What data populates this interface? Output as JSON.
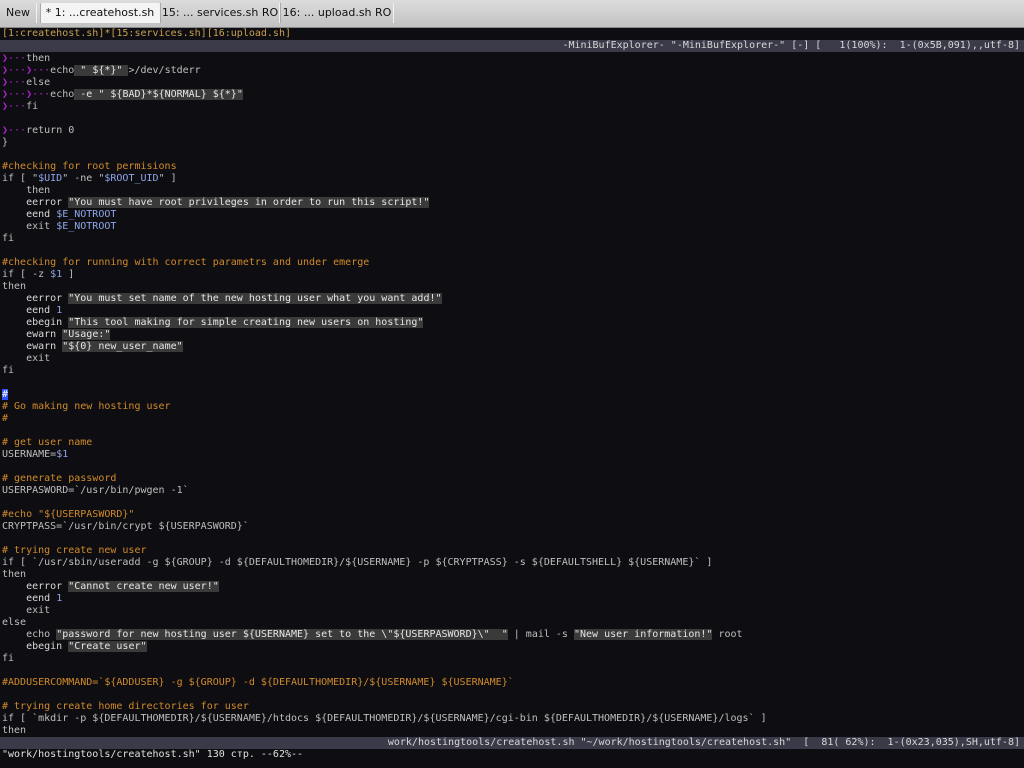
{
  "tabs": [
    {
      "label": "New"
    },
    {
      "label": "* 1: ...createhost.sh"
    },
    {
      "label": "15: ... services.sh RO"
    },
    {
      "label": "16: ... upload.sh RO"
    }
  ],
  "buffer_list": "[1:createhost.sh]*[15:services.sh][16:upload.sh]",
  "minibuf_status": "-MiniBufExplorer- \"-MiniBufExplorer-\" [-] [   1(100%):  1-(0x5B,091),,utf-8]",
  "main_status": "work/hostingtools/createhost.sh \"~/work/hostingtools/createhost.sh\"  [  81( 62%):  1-(0x23,035),SH,utf-8]",
  "cmdline": "\"work/hostingtools/createhost.sh\" 130 стр. --62%--",
  "code_lines": [
    [
      [
        "❯···",
        "ind"
      ],
      [
        "then",
        "kw"
      ]
    ],
    [
      [
        "❯···❯···",
        "ind"
      ],
      [
        "echo",
        "kw"
      ],
      [
        " \" ${*}\" ",
        "str"
      ],
      [
        ">/dev/stderr",
        "kw"
      ]
    ],
    [
      [
        "❯···",
        "ind"
      ],
      [
        "else",
        "kw"
      ]
    ],
    [
      [
        "❯···❯···",
        "ind"
      ],
      [
        "echo",
        "kw"
      ],
      [
        " -e ",
        "str"
      ],
      [
        "\" ${BAD}*${NORMAL} ${*}\"",
        "str"
      ]
    ],
    [
      [
        "❯···",
        "ind"
      ],
      [
        "fi",
        "kw"
      ]
    ],
    [],
    [
      [
        "❯···",
        "ind"
      ],
      [
        "return 0",
        "kw"
      ]
    ],
    [
      [
        "}",
        "kw"
      ]
    ],
    [],
    [
      [
        "#checking for root permisions",
        "cmt"
      ]
    ],
    [
      [
        "if [ \"",
        "kw"
      ],
      [
        "$UID",
        "var"
      ],
      [
        "\" -ne \"",
        "kw"
      ],
      [
        "$ROOT_UID",
        "var"
      ],
      [
        "\" ]",
        "kw"
      ]
    ],
    [
      [
        "    then",
        "kw"
      ]
    ],
    [
      [
        "    eerror ",
        "fn"
      ],
      [
        "\"You must have root privileges in order to run this script!\"",
        "str"
      ]
    ],
    [
      [
        "    eend ",
        "fn"
      ],
      [
        "$E_NOTROOT",
        "var"
      ]
    ],
    [
      [
        "    exit ",
        "kw"
      ],
      [
        "$E_NOTROOT",
        "var"
      ]
    ],
    [
      [
        "fi",
        "kw"
      ]
    ],
    [],
    [
      [
        "#checking for running with correct parametrs and under emerge",
        "cmt"
      ]
    ],
    [
      [
        "if [ -z ",
        "kw"
      ],
      [
        "$1",
        "var"
      ],
      [
        " ]",
        "kw"
      ]
    ],
    [
      [
        "then",
        "kw"
      ]
    ],
    [
      [
        "    eerror ",
        "fn"
      ],
      [
        "\"You must set name of the new hosting user what you want add!\"",
        "str"
      ]
    ],
    [
      [
        "    eend ",
        "fn"
      ],
      [
        "1",
        "num"
      ]
    ],
    [
      [
        "    ebegin ",
        "fn"
      ],
      [
        "\"This tool making for simple creating new users on hosting\"",
        "str"
      ]
    ],
    [
      [
        "    ewarn ",
        "fn"
      ],
      [
        "\"Usage:\"",
        "str"
      ]
    ],
    [
      [
        "    ewarn ",
        "fn"
      ],
      [
        "\"${0} new_user_name\"",
        "str"
      ]
    ],
    [
      [
        "    exit",
        "kw"
      ]
    ],
    [
      [
        "fi",
        "kw"
      ]
    ],
    [],
    [
      [
        "#",
        "cur"
      ]
    ],
    [
      [
        "# Go making new hosting user",
        "cmt"
      ]
    ],
    [
      [
        "#",
        "cmt"
      ]
    ],
    [],
    [
      [
        "# get user name",
        "cmt"
      ]
    ],
    [
      [
        "USERNAME=",
        "kw"
      ],
      [
        "$1",
        "var"
      ]
    ],
    [],
    [
      [
        "# generate password",
        "cmt"
      ]
    ],
    [
      [
        "USERPASWORD=`/usr/bin/pwgen -1`",
        "kw"
      ]
    ],
    [],
    [
      [
        "#echo \"${USERPASWORD}\"",
        "cmt"
      ]
    ],
    [
      [
        "CRYPTPASS=`/usr/bin/crypt ${USERPASWORD}`",
        "kw"
      ]
    ],
    [],
    [
      [
        "# trying create new user",
        "cmt"
      ]
    ],
    [
      [
        "if [ `/usr/sbin/useradd -g ${GROUP} -d ${DEFAULTHOMEDIR}/${USERNAME} -p ${CRYPTPASS} -s ${DEFAULTSHELL} ${USERNAME}` ]",
        "kw"
      ]
    ],
    [
      [
        "then",
        "kw"
      ]
    ],
    [
      [
        "    eerror ",
        "fn"
      ],
      [
        "\"Cannot create new user!\"",
        "str"
      ]
    ],
    [
      [
        "    eend ",
        "fn"
      ],
      [
        "1",
        "num"
      ]
    ],
    [
      [
        "    exit",
        "kw"
      ]
    ],
    [
      [
        "else",
        "kw"
      ]
    ],
    [
      [
        "    echo ",
        "kw"
      ],
      [
        "\"password for new hosting user ${USERNAME} set to the \\\"${USERPASWORD}\\\"  \"",
        "str"
      ],
      [
        " | mail -s ",
        "kw"
      ],
      [
        "\"New user information!\"",
        "str"
      ],
      [
        " root",
        "kw"
      ]
    ],
    [
      [
        "    ebegin ",
        "fn"
      ],
      [
        "\"Create user\"",
        "str"
      ]
    ],
    [
      [
        "fi",
        "kw"
      ]
    ],
    [],
    [
      [
        "#ADDUSERCOMMAND=`${ADDUSER} -g ${GROUP} -d ${DEFAULTHOMEDIR}/${USERNAME} ${USERNAME}`",
        "cmt"
      ]
    ],
    [],
    [
      [
        "# trying create home directories for user",
        "cmt"
      ]
    ],
    [
      [
        "if [ `mkdir -p ${DEFAULTHOMEDIR}/${USERNAME}/htdocs ${DEFAULTHOMEDIR}/${USERNAME}/cgi-bin ${DEFAULTHOMEDIR}/${USERNAME}/logs` ]",
        "kw"
      ]
    ],
    [
      [
        "then",
        "kw"
      ]
    ]
  ]
}
